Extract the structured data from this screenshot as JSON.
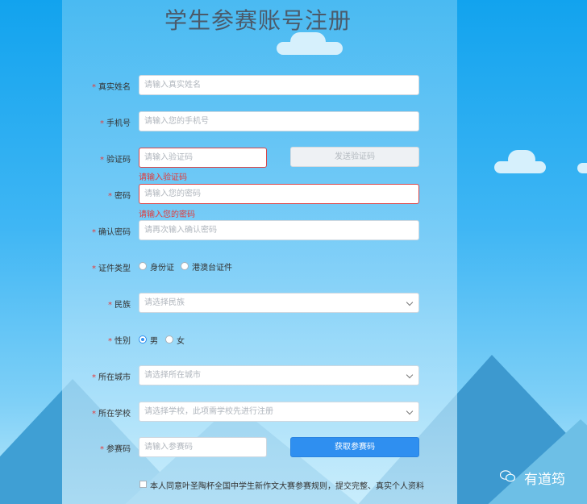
{
  "title": "学生参赛账号注册",
  "fields": {
    "real_name": {
      "label": "真实姓名",
      "placeholder": "请输入真实姓名"
    },
    "phone": {
      "label": "手机号",
      "placeholder": "请输入您的手机号"
    },
    "code": {
      "label": "验证码",
      "placeholder": "请输入验证码",
      "error": "请输入验证码",
      "send_label": "发送验证码"
    },
    "password": {
      "label": "密码",
      "placeholder": "请输入您的密码",
      "error": "请输入您的密码"
    },
    "confirm": {
      "label": "确认密码",
      "placeholder": "请再次输入确认密码"
    },
    "id_type": {
      "label": "证件类型",
      "options": [
        "身份证",
        "港澳台证件"
      ]
    },
    "ethnicity": {
      "label": "民族",
      "placeholder": "请选择民族"
    },
    "gender": {
      "label": "性别",
      "options": [
        "男",
        "女"
      ],
      "selected": "男"
    },
    "city": {
      "label": "所在城市",
      "placeholder": "请选择所在城市"
    },
    "school": {
      "label": "所在学校",
      "placeholder": "请选择学校，此项需学校先进行注册"
    },
    "entry_code": {
      "label": "参赛码",
      "placeholder": "请输入参赛码",
      "button": "获取参赛码"
    }
  },
  "agreement": "本人同意叶圣陶杯全国中学生新作文大赛参赛规则，提交完整、真实个人资料",
  "required_mark": "*",
  "watermark": "有道筠",
  "icons": {
    "dropdown": "chevron-down-icon",
    "watermark": "wechat-icon"
  },
  "colors": {
    "primary": "#2f8ff0",
    "error": "#e23a3a",
    "background": "#3fb6f4"
  }
}
